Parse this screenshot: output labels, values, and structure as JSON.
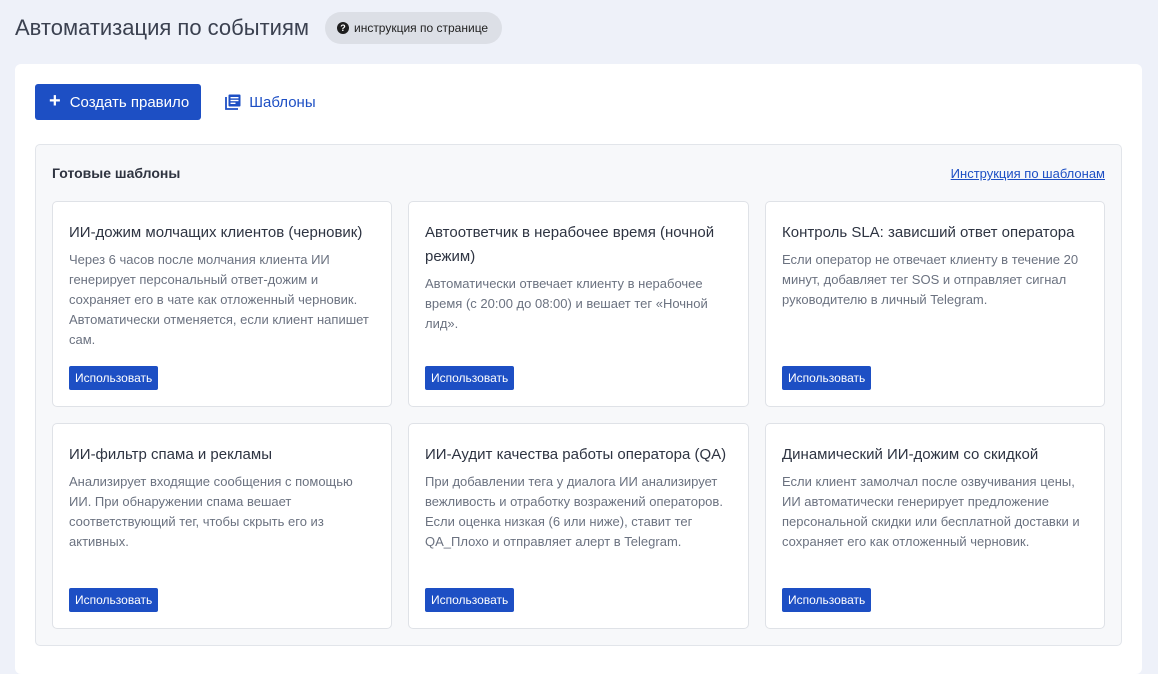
{
  "header": {
    "title": "Автоматизация по событиям",
    "help_label": "инструкция по странице",
    "help_icon": "question-circle-icon"
  },
  "toolbar": {
    "create_label": "Создать правило",
    "create_icon": "plus-icon",
    "templates_label": "Шаблоны",
    "templates_icon": "library-books-icon"
  },
  "templates": {
    "title": "Готовые шаблоны",
    "help_link": "Инструкция по шаблонам",
    "use_label": "Использовать",
    "cards": [
      {
        "title": "ИИ-дожим молчащих клиентов (черновик)",
        "description": "Через 6 часов после молчания клиента ИИ генерирует персональный ответ-дожим и сохраняет его в чате как отложенный черновик. Автоматически отменяется, если клиент напишет сам."
      },
      {
        "title": "Автоответчик в нерабочее время (ночной режим)",
        "description": "Автоматически отвечает клиенту в нерабочее время (с 20:00 до 08:00) и вешает тег «Ночной лид»."
      },
      {
        "title": "Контроль SLA: зависший ответ оператора",
        "description": "Если оператор не отвечает клиенту в течение 20 минут, добавляет тег SOS и отправляет сигнал руководителю в личный Telegram."
      },
      {
        "title": "ИИ-фильтр спама и рекламы",
        "description": "Анализирует входящие сообщения с помощью ИИ. При обнаружении спама вешает соответствующий тег, чтобы скрыть его из активных."
      },
      {
        "title": "ИИ-Аудит качества работы оператора (QA)",
        "description": "При добавлении тега у диалога ИИ анализирует вежливость и отработку возражений операторов. Если оценка низкая (6 или ниже), ставит тег QA_Плохо и отправляет алерт в Telegram."
      },
      {
        "title": "Динамический ИИ-дожим со скидкой",
        "description": "Если клиент замолчал после озвучивания цены, ИИ автоматически генерирует предложение персональной скидки или бесплатной доставки и сохраняет его как отложенный черновик."
      }
    ]
  },
  "colors": {
    "accent": "#1d4fc4",
    "background": "#eef1f9"
  }
}
